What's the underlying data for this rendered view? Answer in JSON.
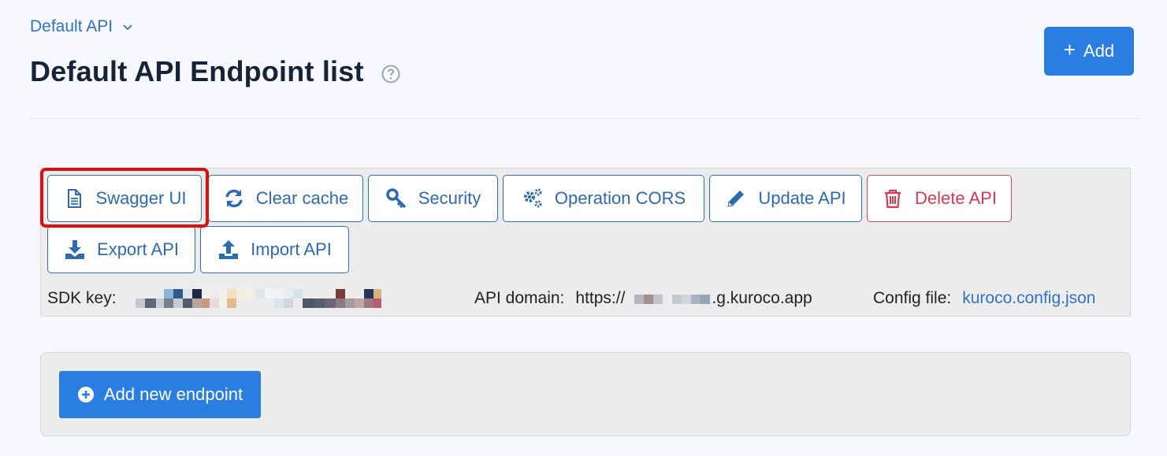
{
  "header": {
    "api_selector": "Default API",
    "title": "Default API Endpoint list",
    "add_button": "Add"
  },
  "toolbar": {
    "buttons": [
      {
        "label": "Swagger UI",
        "icon": "document-icon"
      },
      {
        "label": "Clear cache",
        "icon": "refresh-icon"
      },
      {
        "label": "Security",
        "icon": "key-icon"
      },
      {
        "label": "Operation CORS",
        "icon": "gears-icon"
      },
      {
        "label": "Update API",
        "icon": "pencil-icon"
      },
      {
        "label": "Delete API",
        "icon": "trash-icon"
      },
      {
        "label": "Export API",
        "icon": "download-icon"
      },
      {
        "label": "Import API",
        "icon": "upload-icon"
      }
    ]
  },
  "info": {
    "sdk_key_label": "SDK key:",
    "api_domain_label": "API domain:",
    "api_domain_prefix": "https://",
    "api_domain_suffix": ".g.kuroco.app",
    "config_file_label": "Config file:",
    "config_file_link": "kuroco.config.json"
  },
  "endpoints": {
    "add_new_button": "Add new endpoint"
  },
  "colors": {
    "primary": "#2a7de1",
    "outline": "#2f6fb5",
    "danger": "#d83a52",
    "highlight": "#e00f0f"
  }
}
